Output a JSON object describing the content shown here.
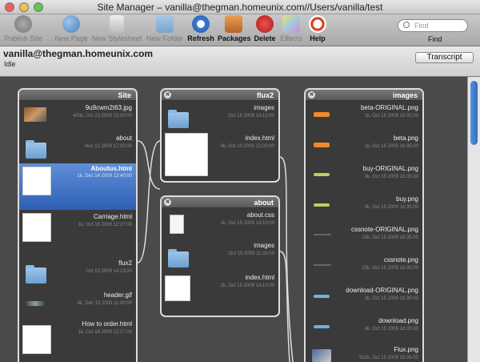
{
  "window": {
    "title": "Site Manager – vanilla@thegman.homeunix.com//Users/vanilla/test",
    "traffic_colors": [
      "#ee5f5b",
      "#f5be4f",
      "#62c554"
    ]
  },
  "toolbar": {
    "items": [
      {
        "label": "Publish Site",
        "icon": "publish-site-icon",
        "enabled": false
      },
      {
        "label": "New Page",
        "icon": "globe-icon",
        "enabled": false
      },
      {
        "label": "New Stylesheet",
        "icon": "stylesheet-icon",
        "enabled": false
      },
      {
        "label": "New Folder",
        "icon": "folder-icon",
        "enabled": false
      },
      {
        "label": "Refresh",
        "icon": "refresh-icon",
        "enabled": true
      },
      {
        "label": "Packages",
        "icon": "packages-icon",
        "enabled": true
      },
      {
        "label": "Delete",
        "icon": "delete-icon",
        "enabled": true
      },
      {
        "label": "Effects",
        "icon": "effects-icon",
        "enabled": false
      },
      {
        "label": "Help",
        "icon": "help-icon",
        "enabled": true
      }
    ],
    "search_placeholder": "Find",
    "find_label": "Find"
  },
  "info": {
    "connection": "vanilla@thegman.homeunix.com",
    "status": "Idle",
    "transcript_label": "Transcript"
  },
  "columns": {
    "site": {
      "title": "Site",
      "items": [
        {
          "name": "9u9cwm2t63.jpg",
          "meta": "400k, Oct 23 2009 15:00:00",
          "kind": "image"
        },
        {
          "name": "about",
          "meta": "Nov 12 2009 17:02:00",
          "kind": "folder"
        },
        {
          "name": "Aboutus.html",
          "meta": "1k, Dec 14 2009 13:40:00",
          "kind": "doc",
          "selected": true
        },
        {
          "name": "Carriage.html",
          "meta": "1k, Oct 16 2009 12:27:00",
          "kind": "doc"
        },
        {
          "name": "flux2",
          "meta": "Oct 15 2009 14:13:00",
          "kind": "folder"
        },
        {
          "name": "header.gif",
          "meta": "6k, Dec 15 2009 11:00:00",
          "kind": "gif"
        },
        {
          "name": "How to order.html",
          "meta": "1k, Oct 16 2009 12:27:00",
          "kind": "doc"
        }
      ]
    },
    "flux2": {
      "title": "flux2",
      "items": [
        {
          "name": "images",
          "meta": "Oct 15 2009 14:13:00",
          "kind": "folder"
        },
        {
          "name": "index.html",
          "meta": "9k, Oct 20 2009 12:00:00",
          "kind": "page"
        }
      ]
    },
    "about": {
      "title": "about",
      "items": [
        {
          "name": "about.css",
          "meta": "1k, Oct 15 2009 14:10:00",
          "kind": "doc"
        },
        {
          "name": "images",
          "meta": "Oct 15 2009 11:33:00",
          "kind": "folder"
        },
        {
          "name": "index.html",
          "meta": "2k, Oct 15 2009 14:10:00",
          "kind": "page"
        }
      ]
    },
    "images": {
      "title": "images",
      "items": [
        {
          "name": "beta-ORIGINAL.png",
          "meta": "1k, Oct 15 2009 16:35:00",
          "swatch": "#f08a2a"
        },
        {
          "name": "beta.png",
          "meta": "1k, Oct 15 2009 16:35:00",
          "swatch": "#f08a2a"
        },
        {
          "name": "buy-ORIGINAL.png",
          "meta": "3k, Oct 15 2009 16:35:00",
          "swatch": "#b8d25a"
        },
        {
          "name": "buy.png",
          "meta": "3k, Oct 15 2009 16:35:00",
          "swatch": "#b8d25a"
        },
        {
          "name": "cssnote-ORIGINAL.png",
          "meta": "15k, Oct 15 2009 16:35:00",
          "swatch": "#666666"
        },
        {
          "name": "cssnote.png",
          "meta": "15k, Oct 15 2009 16:35:00",
          "swatch": "#666666"
        },
        {
          "name": "download-ORIGINAL.png",
          "meta": "3k, Oct 15 2009 16:35:00",
          "swatch": "#6fb0e0"
        },
        {
          "name": "download.png",
          "meta": "3k, Oct 15 2009 16:35:00",
          "swatch": "#6fb0e0"
        },
        {
          "name": "Flux.png",
          "meta": "521k, Oct 15 2009 16:36:00",
          "swatch": "#4a6a9a"
        }
      ]
    }
  }
}
